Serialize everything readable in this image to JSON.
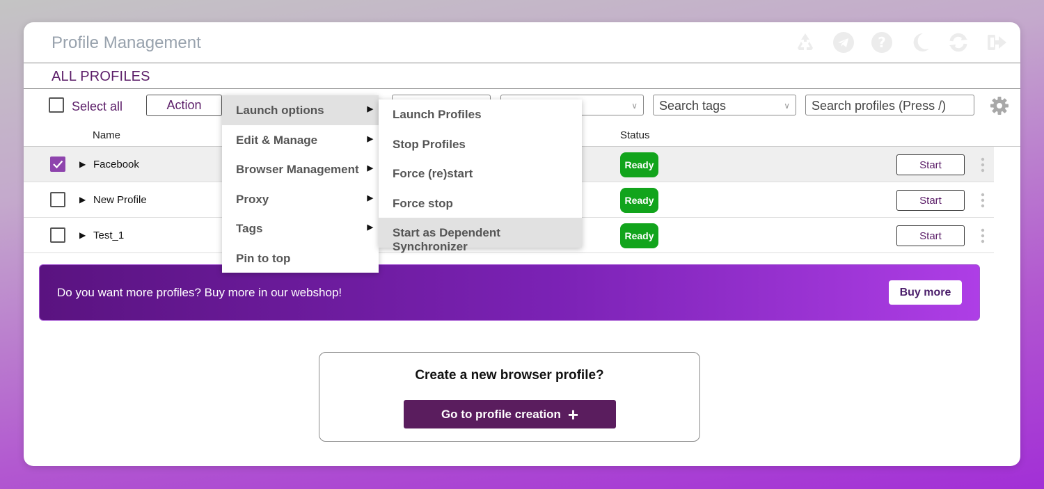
{
  "app": {
    "title": "Profile Management"
  },
  "title_icons": [
    "recycle-icon",
    "telegram-icon",
    "help-icon",
    "moon-icon",
    "refresh-icon",
    "logout-icon"
  ],
  "section": {
    "title": "ALL PROFILES"
  },
  "toolbar": {
    "select_all_label": "Select all",
    "action_label": "Action",
    "tags_placeholder": "Search tags",
    "search_placeholder": "Search profiles (Press /)"
  },
  "columns": {
    "name": "Name",
    "status": "Status"
  },
  "profiles": [
    {
      "name": "Facebook",
      "status": "Ready",
      "action": "Start",
      "checked": true
    },
    {
      "name": "New Profile",
      "status": "Ready",
      "action": "Start",
      "checked": false
    },
    {
      "name": "Test_1",
      "status": "Ready",
      "action": "Start",
      "checked": false
    }
  ],
  "action_menu": {
    "items": [
      "Launch options",
      "Edit & Manage",
      "Browser Management",
      "Proxy",
      "Tags",
      "Pin to top"
    ],
    "active": "Launch options"
  },
  "launch_submenu": {
    "items": [
      "Launch Profiles",
      "Stop Profiles",
      "Force (re)start",
      "Force stop",
      "Start as Dependent Synchronizer"
    ],
    "hovered": "Start as Dependent Synchronizer"
  },
  "promo": {
    "text": "Do you want more profiles? Buy more in our webshop!",
    "button": "Buy more"
  },
  "create": {
    "title": "Create a new browser profile?",
    "button": "Go to profile creation"
  },
  "colors": {
    "accent": "#5b1d68",
    "status_ready": "#12a41c",
    "checkbox_checked": "#8e44ad",
    "create_button": "#5a1d5e"
  }
}
